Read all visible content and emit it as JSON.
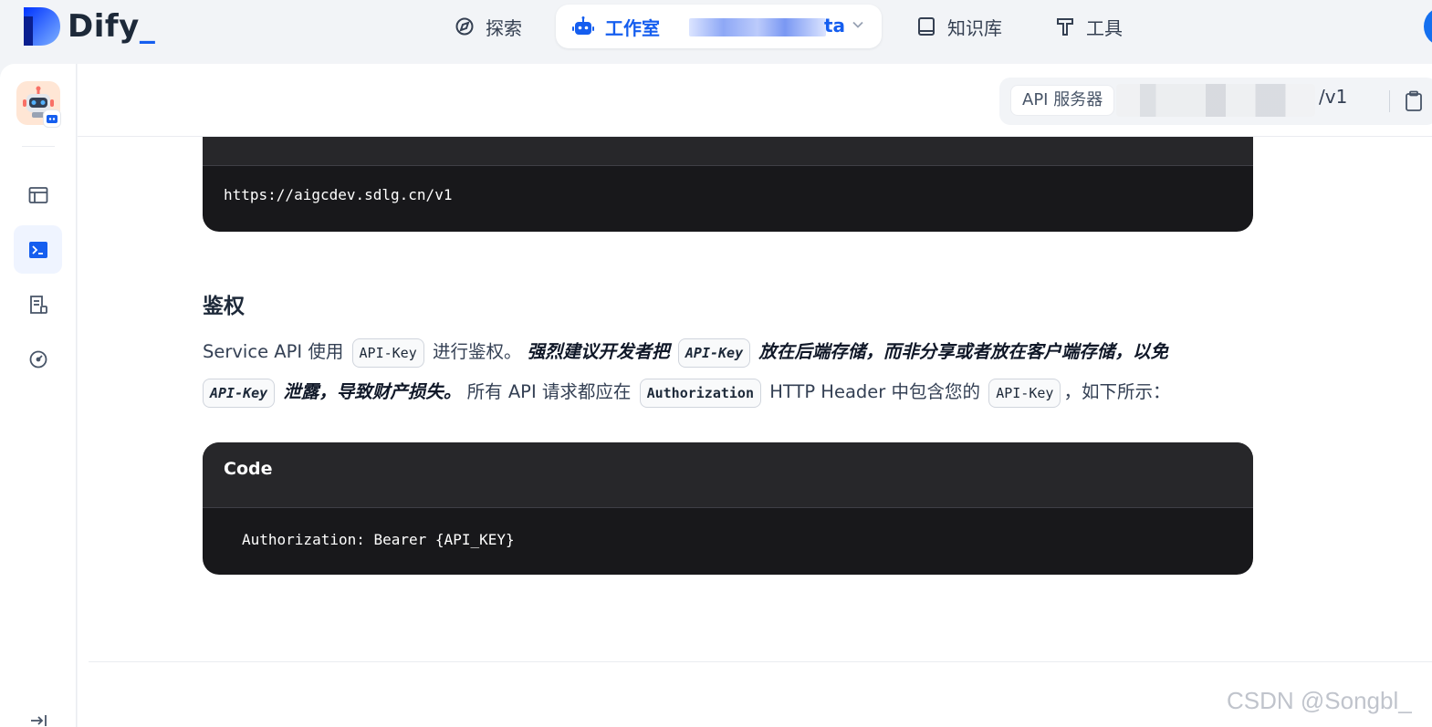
{
  "brand": {
    "name": "Dify",
    "cursor": "_"
  },
  "nav": {
    "explore": "探索",
    "studio": "工作室",
    "workspace_suffix": "ta",
    "knowledge": "知识库",
    "tools": "工具"
  },
  "api_server": {
    "label": "API 服务器",
    "suffix": "/v1"
  },
  "doc": {
    "base_url_code": "https://aigcdev.sdlg.cn/v1",
    "auth_title": "鉴权",
    "para": {
      "t1": "Service API 使用",
      "c1": "API-Key",
      "t2": "进行鉴权。",
      "b1": "强烈建议开发者把",
      "c2": "API-Key",
      "b2": "放在后端存储，而非分享或者放在客户端存储，以免",
      "c3": "API-Key",
      "b3": "泄露，导致财产损失。",
      "t3": "所有 API 请求都应在",
      "c4": "Authorization",
      "t4": "HTTP Header 中包含您的",
      "c5": "API-Key",
      "t5": "，如下所示："
    },
    "code_title": "Code",
    "code_body": "Authorization: Bearer {API_KEY}"
  },
  "watermark": "CSDN @Songbl_",
  "colors": {
    "accent": "#155eef",
    "code_bg": "#18181b",
    "code_header": "#27272a"
  }
}
